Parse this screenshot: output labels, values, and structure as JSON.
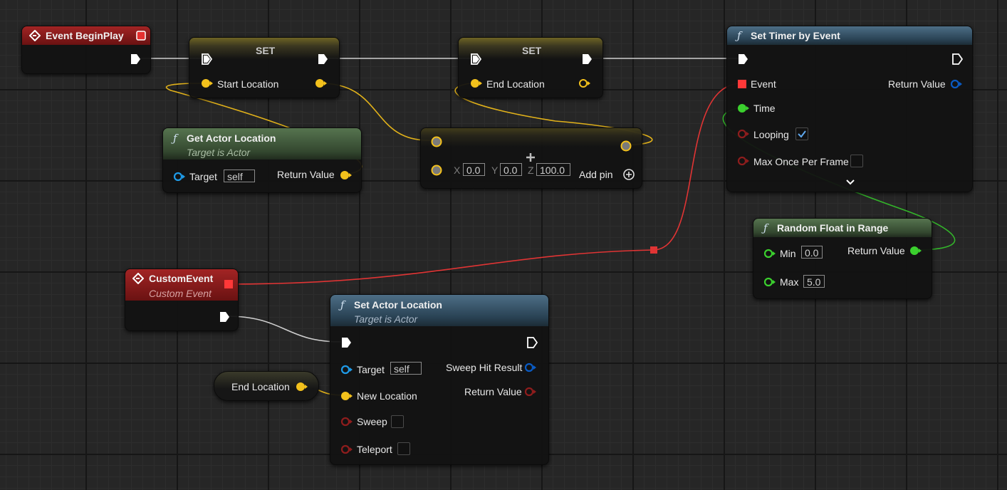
{
  "nodes": {
    "event_begin_play": {
      "title": "Event BeginPlay"
    },
    "set_start": {
      "title": "SET",
      "var": "Start Location"
    },
    "set_end": {
      "title": "SET",
      "var": "End Location"
    },
    "get_actor_location": {
      "title": "Get Actor Location",
      "subtitle": "Target is Actor",
      "target_label": "Target",
      "target_value": "self",
      "return_label": "Return Value"
    },
    "make_vector": {
      "x_label": "X",
      "x_value": "0.0",
      "y_label": "Y",
      "y_value": "0.0",
      "z_label": "Z",
      "z_value": "100.0",
      "add_pin": "Add pin"
    },
    "set_timer": {
      "title": "Set Timer by Event",
      "event_label": "Event",
      "return_label": "Return Value",
      "time_label": "Time",
      "looping_label": "Looping",
      "looping_checked": true,
      "max_once_label": "Max Once Per Frame",
      "max_once_checked": false
    },
    "random_float": {
      "title": "Random Float in Range",
      "min_label": "Min",
      "min_value": "0.0",
      "max_label": "Max",
      "max_value": "5.0",
      "return_label": "Return Value"
    },
    "custom_event": {
      "title": "CustomEvent",
      "subtitle": "Custom Event"
    },
    "set_actor_location": {
      "title": "Set Actor Location",
      "subtitle": "Target is Actor",
      "target_label": "Target",
      "target_value": "self",
      "sweep_hit_label": "Sweep Hit Result",
      "new_location_label": "New Location",
      "return_label": "Return Value",
      "sweep_label": "Sweep",
      "teleport_label": "Teleport"
    },
    "end_location_getter": {
      "label": "End Location"
    }
  },
  "colors": {
    "exec": "#ffffff",
    "vector": "#f3c11c",
    "float": "#3bd02e",
    "boolean": "#8f1d1d",
    "delegate": "#ff3838",
    "object": "#1f9be8",
    "struct": "#0a5bc4"
  }
}
